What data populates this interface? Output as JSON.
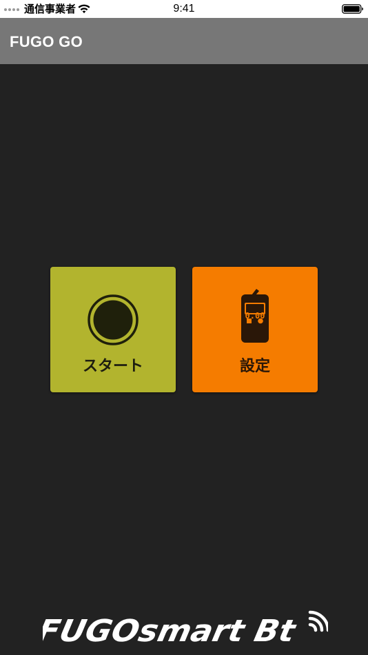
{
  "status_bar": {
    "carrier": "通信事業者",
    "time": "9:41"
  },
  "header": {
    "title": "FUGO GO"
  },
  "tiles": {
    "start": {
      "label": "スタート",
      "icon": "record-circle-icon",
      "color": "#b2b42e"
    },
    "settings": {
      "label": "設定",
      "icon": "breathalyzer-icon",
      "color": "#f57c00",
      "display_value": "0.00"
    }
  },
  "brand": {
    "logo_text": "FUGOsmart Bt"
  },
  "colors": {
    "background": "#222222",
    "header": "#777777",
    "status_bar": "#ffffff"
  }
}
